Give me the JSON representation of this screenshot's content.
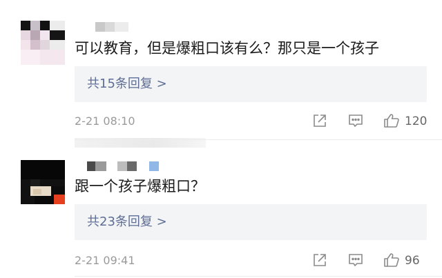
{
  "comments": [
    {
      "text": "可以教育，但是爆粗口该有么？那只是一个孩子",
      "replies_label": "共15条回复 >",
      "timestamp": "2-21 08:10",
      "like_count": "120",
      "icons": {
        "share": "share-icon",
        "comment": "comment-icon",
        "like": "thumbs-up-icon"
      }
    },
    {
      "text": "跟一个孩子爆粗口？",
      "replies_label": "共23条回复 >",
      "timestamp": "2-21 09:41",
      "like_count": "96",
      "icons": {
        "share": "share-icon",
        "comment": "comment-icon",
        "like": "thumbs-up-icon"
      }
    }
  ],
  "colors": {
    "reply_link": "#5d6d94",
    "reply_box_bg": "#f3f4f6",
    "meta_gray": "#9a9a9a",
    "icon_gray": "#8a8a8a"
  }
}
